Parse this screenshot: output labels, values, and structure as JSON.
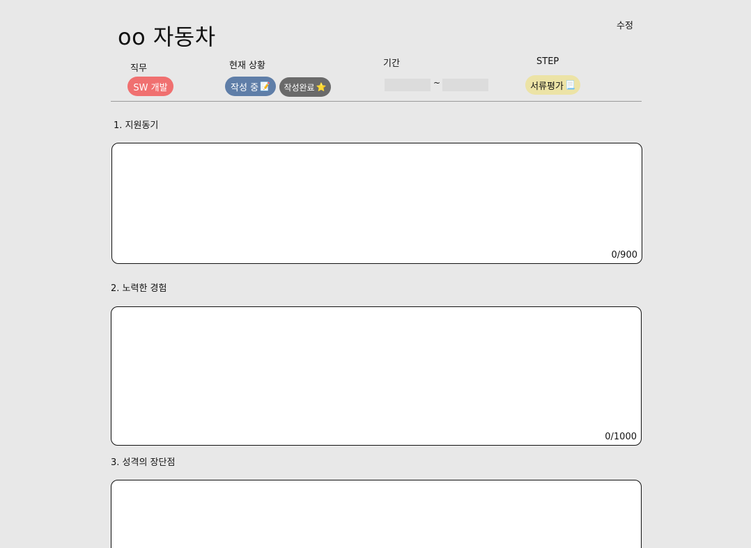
{
  "header": {
    "title": "oo 자동차",
    "edit_label": "수정"
  },
  "meta": {
    "role_label": "직무",
    "role_value": "SW 개발",
    "status_label": "현재 상황",
    "status_writing": "작성 중",
    "status_writing_icon": "📝",
    "status_done": "작성완료",
    "status_done_icon": "⭐",
    "period_label": "기간",
    "period_separator": "~",
    "period_start": "",
    "period_end": "",
    "step_label": "STEP",
    "step_value": "서류평가",
    "step_icon": "📃"
  },
  "questions": [
    {
      "title": "1. 지원동기",
      "answer": "",
      "counter": "0/900"
    },
    {
      "title": "2. 노력한 경험",
      "answer": "",
      "counter": "0/1000"
    },
    {
      "title": "3. 성격의 장단점",
      "answer": "",
      "counter": ""
    }
  ],
  "colors": {
    "background": "#e8e8e8",
    "role_pill": "#f07070",
    "writing_pill": "#5f7ea8",
    "done_pill": "#6a6a6a",
    "step_pill": "#ece3a6"
  }
}
